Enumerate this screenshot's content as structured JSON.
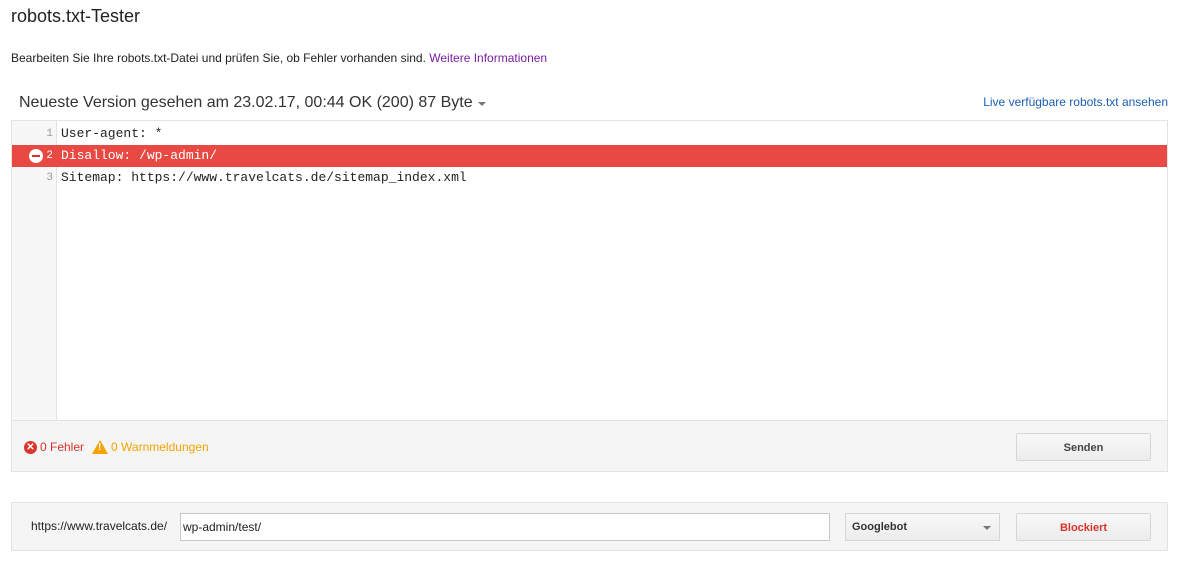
{
  "header": {
    "title": "robots.txt-Tester",
    "intro_text": "Bearbeiten Sie Ihre robots.txt-Datei und prüfen Sie, ob Fehler vorhanden sind. ",
    "intro_link": "Weitere Informationen"
  },
  "version": {
    "label": "Neueste Version gesehen am 23.02.17, 00:44 OK (200) 87 Byte",
    "live_link": "Live verfügbare robots.txt ansehen"
  },
  "editor": {
    "lines": [
      {
        "number": "1",
        "text": "User-agent: *"
      },
      {
        "number": "2",
        "text": "Disallow: /wp-admin/"
      },
      {
        "number": "3",
        "text": "Sitemap: https://www.travelcats.de/sitemap_index.xml"
      }
    ],
    "highlighted_line": 2,
    "highlight_color": "#e84a43"
  },
  "status": {
    "errors": "0 Fehler",
    "warnings": "0 Warnmeldungen",
    "error_color": "#d9342b",
    "warning_color": "#f4a300"
  },
  "buttons": {
    "send": "Senden"
  },
  "test": {
    "url_prefix": "https://www.travelcats.de/",
    "url_value": "wp-admin/test/",
    "bot_selected": "Googlebot",
    "result_label": "Blockiert",
    "result_color": "#d9342b"
  }
}
